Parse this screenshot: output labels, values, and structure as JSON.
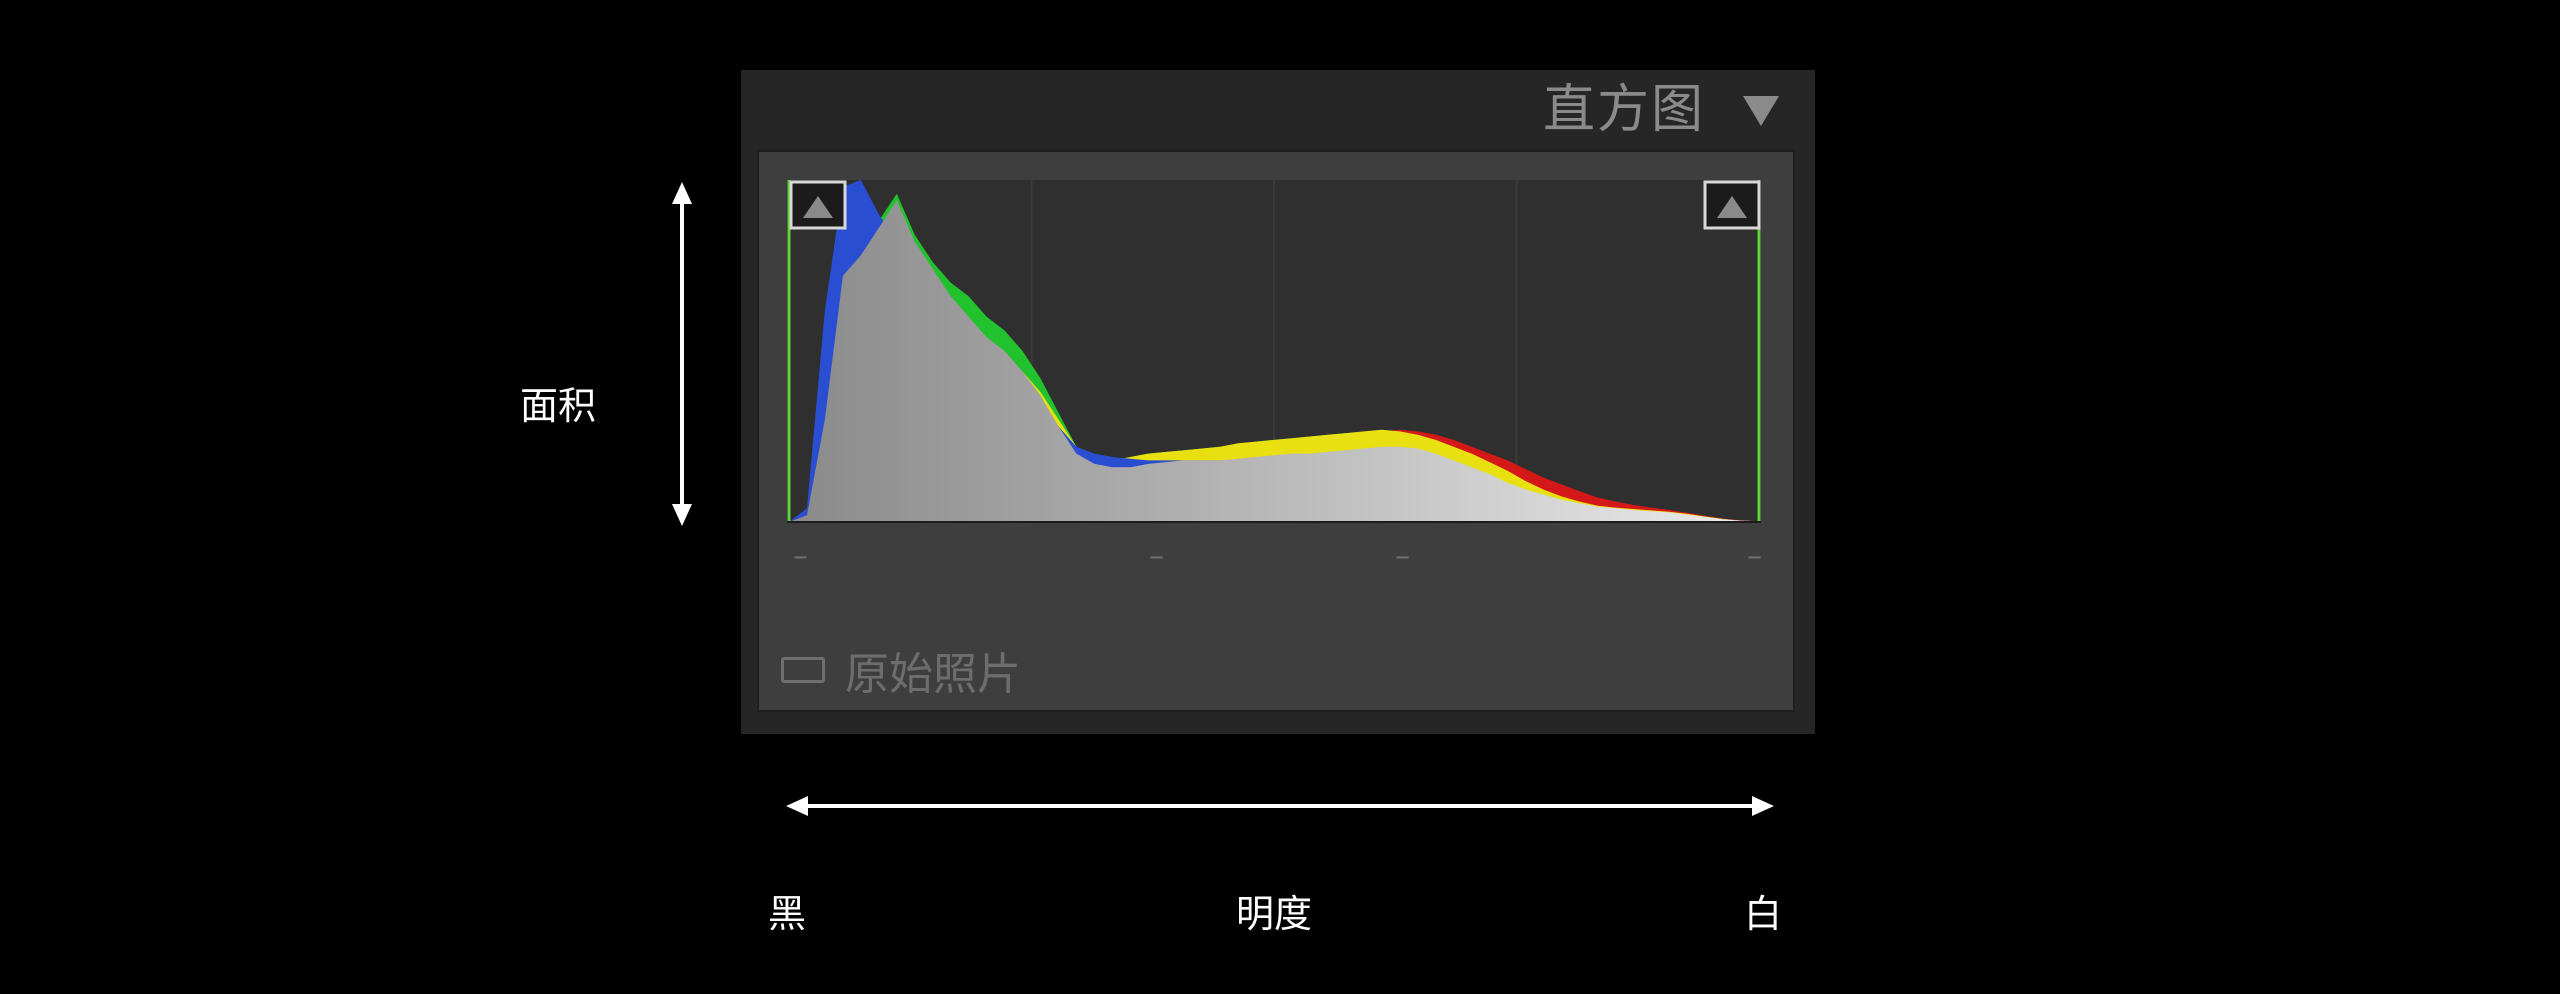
{
  "panel": {
    "title": "直方图",
    "collapse_icon": "triangle-down-icon",
    "shadow_clip_icon": "triangle-up-icon",
    "highlight_clip_icon": "triangle-up-icon",
    "original_photo_label": "原始照片",
    "original_photo_checked": false
  },
  "histogram": {
    "channels": {
      "luminance": {
        "color": "#d0d0d0",
        "values": [
          0,
          0.02,
          0.3,
          0.72,
          0.78,
          0.86,
          0.94,
          0.82,
          0.74,
          0.66,
          0.6,
          0.54,
          0.5,
          0.44,
          0.37,
          0.28,
          0.2,
          0.17,
          0.16,
          0.16,
          0.17,
          0.175,
          0.18,
          0.18,
          0.18,
          0.185,
          0.19,
          0.195,
          0.2,
          0.2,
          0.205,
          0.21,
          0.215,
          0.22,
          0.22,
          0.215,
          0.2,
          0.18,
          0.16,
          0.14,
          0.115,
          0.095,
          0.08,
          0.065,
          0.055,
          0.045,
          0.04,
          0.035,
          0.032,
          0.028,
          0.022,
          0.015,
          0.008,
          0.004,
          0.002
        ]
      },
      "yellow": {
        "color": "#e8e010",
        "values": [
          0,
          0.02,
          0.28,
          0.7,
          0.76,
          0.84,
          0.92,
          0.8,
          0.72,
          0.64,
          0.58,
          0.5,
          0.48,
          0.44,
          0.38,
          0.3,
          0.22,
          0.19,
          0.18,
          0.19,
          0.2,
          0.205,
          0.21,
          0.215,
          0.22,
          0.23,
          0.235,
          0.24,
          0.245,
          0.25,
          0.255,
          0.26,
          0.265,
          0.27,
          0.265,
          0.255,
          0.24,
          0.22,
          0.2,
          0.175,
          0.15,
          0.12,
          0.095,
          0.075,
          0.06,
          0.048,
          0.042,
          0.038,
          0.034,
          0.03,
          0.024,
          0.016,
          0.009,
          0.004,
          0.002
        ]
      },
      "green": {
        "color": "#22c22e",
        "values": [
          0,
          0.02,
          0.3,
          0.74,
          0.8,
          0.88,
          0.96,
          0.84,
          0.76,
          0.7,
          0.66,
          0.6,
          0.56,
          0.5,
          0.42,
          0.32,
          0.22,
          0.19,
          0.18,
          0.19,
          0.2,
          0.205,
          0.21,
          0.215,
          0.22,
          0.225,
          0.235,
          0.24,
          0.245,
          0.25,
          0.255,
          0.26,
          0.262,
          0.264,
          0.26,
          0.25,
          0.235,
          0.215,
          0.19,
          0.165,
          0.14,
          0.115,
          0.09,
          0.07,
          0.055,
          0.045,
          0.04,
          0.036,
          0.032,
          0.028,
          0.022,
          0.015,
          0.008,
          0.004,
          0.002
        ]
      },
      "red": {
        "color": "#d41818",
        "values": [
          0,
          0.01,
          0.12,
          0.5,
          0.62,
          0.72,
          0.8,
          0.72,
          0.64,
          0.56,
          0.5,
          0.45,
          0.42,
          0.38,
          0.32,
          0.25,
          0.19,
          0.17,
          0.16,
          0.165,
          0.17,
          0.175,
          0.18,
          0.185,
          0.19,
          0.2,
          0.21,
          0.22,
          0.23,
          0.24,
          0.245,
          0.25,
          0.255,
          0.265,
          0.27,
          0.265,
          0.255,
          0.24,
          0.22,
          0.2,
          0.18,
          0.155,
          0.13,
          0.11,
          0.09,
          0.072,
          0.06,
          0.05,
          0.042,
          0.035,
          0.027,
          0.018,
          0.01,
          0.005,
          0.002
        ]
      },
      "blue": {
        "color": "#2a4ed2",
        "values": [
          0,
          0.04,
          0.62,
          0.98,
          1.0,
          0.9,
          0.82,
          0.72,
          0.66,
          0.6,
          0.55,
          0.5,
          0.46,
          0.42,
          0.36,
          0.28,
          0.22,
          0.2,
          0.19,
          0.185,
          0.18,
          0.18,
          0.18,
          0.18,
          0.18,
          0.18,
          0.18,
          0.18,
          0.18,
          0.18,
          0.18,
          0.18,
          0.18,
          0.175,
          0.17,
          0.165,
          0.155,
          0.14,
          0.125,
          0.11,
          0.095,
          0.08,
          0.068,
          0.058,
          0.05,
          0.043,
          0.038,
          0.034,
          0.03,
          0.026,
          0.02,
          0.014,
          0.008,
          0.004,
          0.002
        ]
      },
      "magenta": {
        "color": "#c42aa8",
        "values": [
          0,
          0.02,
          0.22,
          0.66,
          0.74,
          0.8,
          0.78,
          0.7,
          0.62,
          0.55,
          0.5,
          0.45,
          0.42,
          0.38,
          0.32,
          0.25,
          0.19,
          0.17,
          0.16,
          0.16,
          0.16,
          0.165,
          0.17,
          0.17,
          0.17,
          0.175,
          0.18,
          0.185,
          0.19,
          0.19,
          0.195,
          0.2,
          0.2,
          0.205,
          0.205,
          0.2,
          0.19,
          0.17,
          0.15,
          0.13,
          0.11,
          0.09,
          0.075,
          0.062,
          0.052,
          0.044,
          0.038,
          0.034,
          0.03,
          0.026,
          0.02,
          0.014,
          0.008,
          0.004,
          0.002
        ]
      }
    },
    "info_dashes": [
      "–",
      "–",
      "–",
      "–"
    ]
  },
  "annotations": {
    "vertical_axis_label": "面积",
    "horizontal_axis_label": "明度",
    "left_end_label": "黑",
    "right_end_label": "白",
    "arrow_color": "#ffffff"
  }
}
